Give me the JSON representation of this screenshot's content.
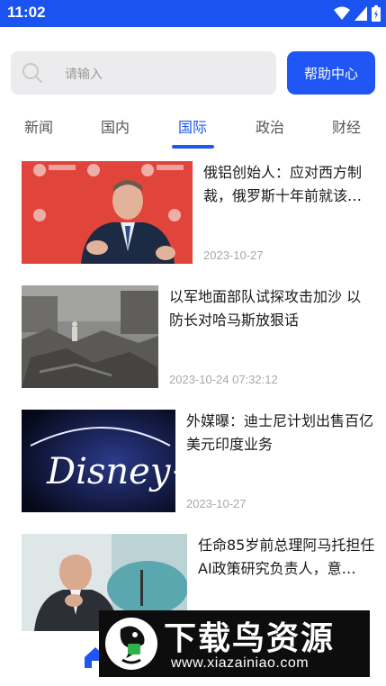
{
  "status_bar": {
    "time": "11:02",
    "icons": [
      "wifi-icon",
      "signal-icon",
      "battery-icon"
    ]
  },
  "search": {
    "placeholder": "请输入",
    "help_label": "帮助中心"
  },
  "tabs": [
    {
      "label": "新闻",
      "active": false
    },
    {
      "label": "国内",
      "active": false
    },
    {
      "label": "国际",
      "active": true
    },
    {
      "label": "政治",
      "active": false
    },
    {
      "label": "财经",
      "active": false
    }
  ],
  "news": [
    {
      "title": "俄铝创始人：应对西方制裁，俄罗斯十年前就该…",
      "date": "2023-10-27"
    },
    {
      "title": "以军地面部队试探攻击加沙 以防长对哈马斯放狠话",
      "date": "2023-10-24 07:32:12"
    },
    {
      "title": "外媒曝：迪士尼计划出售百亿美元印度业务",
      "date": "2023-10-27",
      "thumb_text": "Disney+"
    },
    {
      "title": "任命85岁前总理阿马托担任AI政策研究负责人，意…",
      "date": ""
    }
  ],
  "watermark": {
    "title": "下载鸟资源",
    "url": "www.xiazainiao.com"
  },
  "colors": {
    "accent": "#1f56f5",
    "status_bar": "#1a53f0"
  }
}
